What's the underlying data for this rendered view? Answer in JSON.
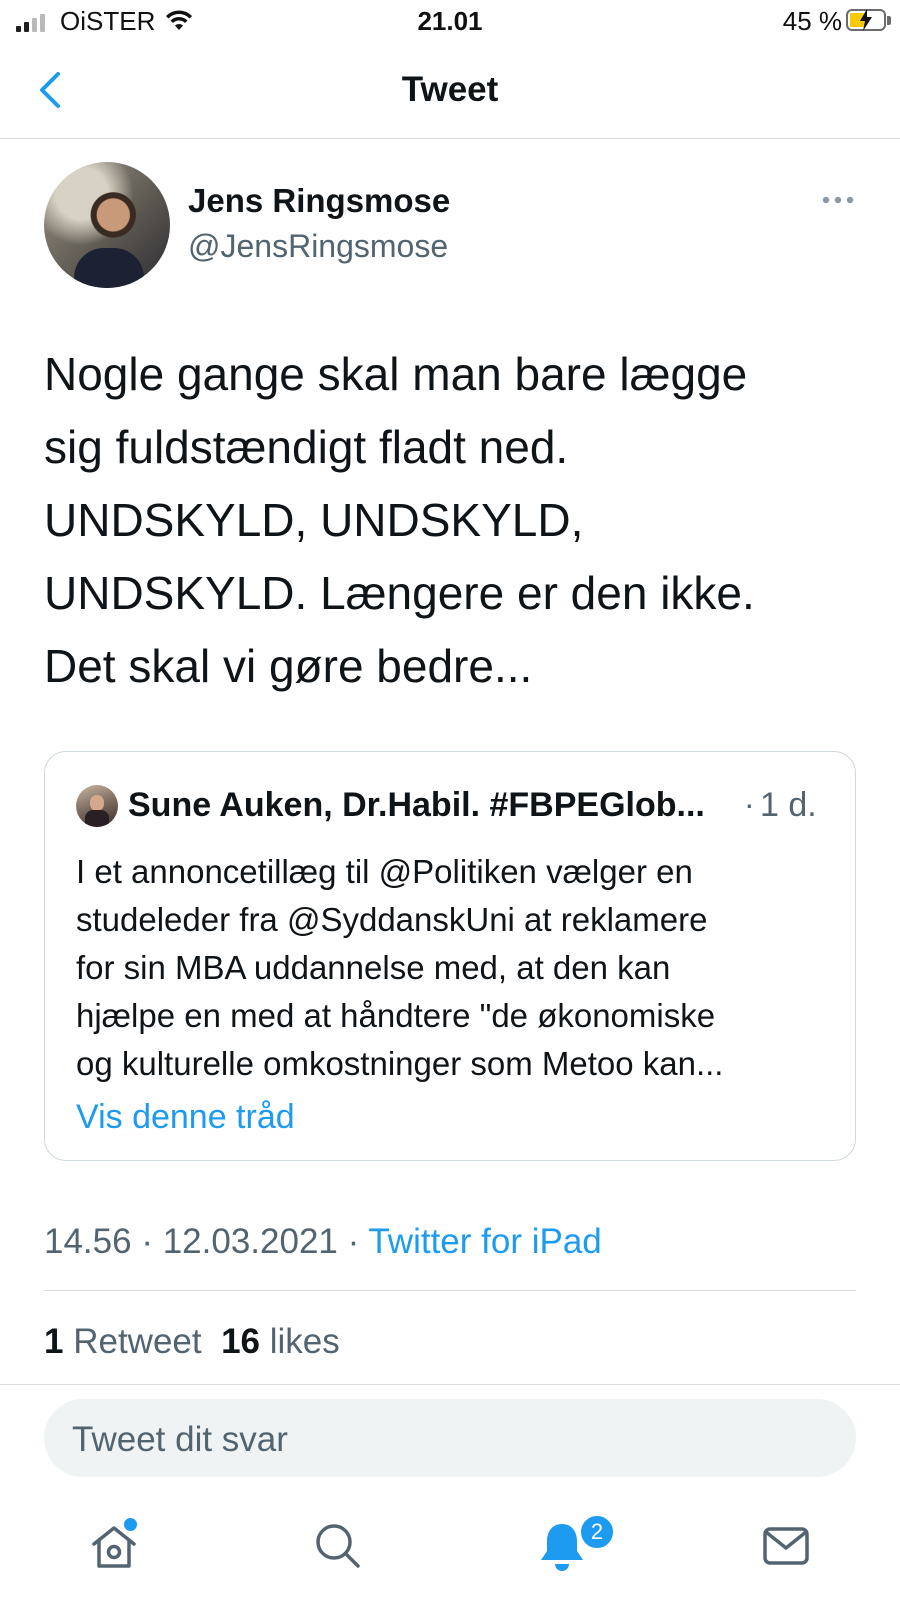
{
  "status_bar": {
    "carrier": "OiSTER",
    "time": "21.01",
    "battery_percent_label": "45 %",
    "battery_level": 0.45,
    "signal_bars_active": 2,
    "signal_bars_total": 4
  },
  "header": {
    "title": "Tweet",
    "back_icon": "chevron-left-icon",
    "accent_color": "#1d9bf0"
  },
  "tweet": {
    "author_name": "Jens Ringsmose",
    "author_handle": "@JensRingsmose",
    "more_icon": "more-horizontal-icon",
    "text_lines": [
      "Nogle gange skal man bare lægge",
      "sig fuldstændigt fladt ned.",
      "UNDSKYLD, UNDSKYLD,",
      "UNDSKYLD. Længere er den ikke.",
      "Det skal vi gøre bedre..."
    ],
    "quoted": {
      "author_name": "Sune Auken, Dr.Habil. #FBPEGlob...",
      "separator": "·",
      "time": "1 d.",
      "text_lines": [
        "I et annoncetillæg til @Politiken vælger en",
        "studeleder fra @SyddanskUni at reklamere",
        "for sin MBA uddannelse med, at den kan",
        "hjælpe en med at håndtere \"de økonomiske",
        "og kulturelle omkostninger som Metoo kan..."
      ],
      "show_thread": "Vis denne tråd"
    },
    "time": "14.56",
    "dot1": " · ",
    "date": "12.03.2021",
    "dot2": " · ",
    "source": "Twitter for iPad",
    "retweet_count": "1",
    "retweet_label": "Retweet",
    "like_count": "16",
    "like_label": "likes"
  },
  "reply_box": {
    "placeholder": "Tweet dit svar"
  },
  "tab_bar": {
    "tabs": [
      {
        "name": "home",
        "icon": "home-icon",
        "has_dot": true
      },
      {
        "name": "search",
        "icon": "search-icon"
      },
      {
        "name": "notifications",
        "icon": "bell-icon",
        "active": true,
        "badge": "2"
      },
      {
        "name": "messages",
        "icon": "mail-icon"
      }
    ]
  }
}
